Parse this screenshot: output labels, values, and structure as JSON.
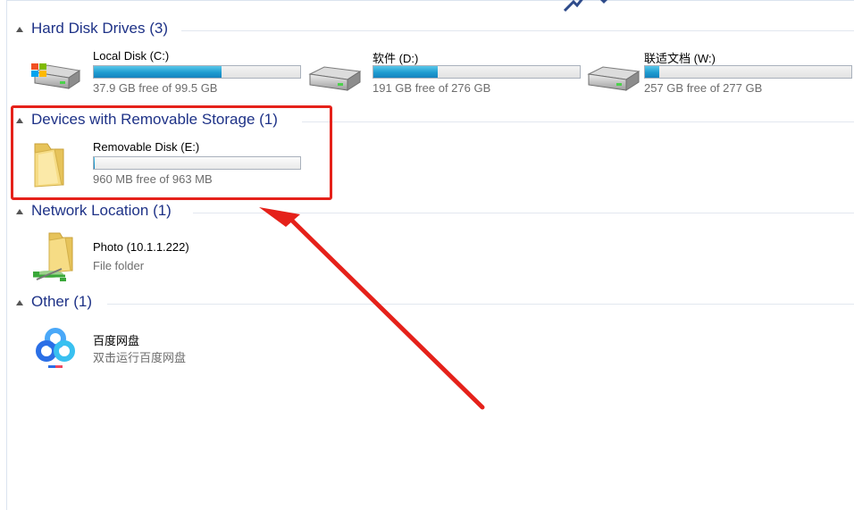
{
  "colors": {
    "accent": "#1e3287",
    "bar_fill": "#26a7db",
    "highlight_red": "#e5211a"
  },
  "sections": {
    "hdd": {
      "title": "Hard Disk Drives (3)",
      "items": [
        {
          "name": "Local Disk (C:)",
          "free": "37.9 GB free of 99.5 GB",
          "used_fraction": 0.62,
          "icon": "windows-drive-icon"
        },
        {
          "name": "软件 (D:)",
          "free": "191 GB free of 276 GB",
          "used_fraction": 0.31,
          "icon": "hard-drive-icon"
        },
        {
          "name": "联适文档 (W:)",
          "free": "257 GB free of 277 GB",
          "used_fraction": 0.07,
          "icon": "hard-drive-icon"
        }
      ]
    },
    "removable": {
      "title": "Devices with Removable Storage (1)",
      "items": [
        {
          "name": "Removable Disk (E:)",
          "free": "960 MB free of 963 MB",
          "used_fraction": 0.003,
          "icon": "folder-icon"
        }
      ]
    },
    "network": {
      "title": "Network Location (1)",
      "items": [
        {
          "name": "Photo (10.1.1.222)",
          "subtitle": "File folder",
          "icon": "network-folder-icon"
        }
      ]
    },
    "other": {
      "title": "Other (1)",
      "items": [
        {
          "name": "百度网盘",
          "subtitle": "双击运行百度网盘",
          "icon": "baidu-netdisk-icon"
        }
      ]
    }
  }
}
